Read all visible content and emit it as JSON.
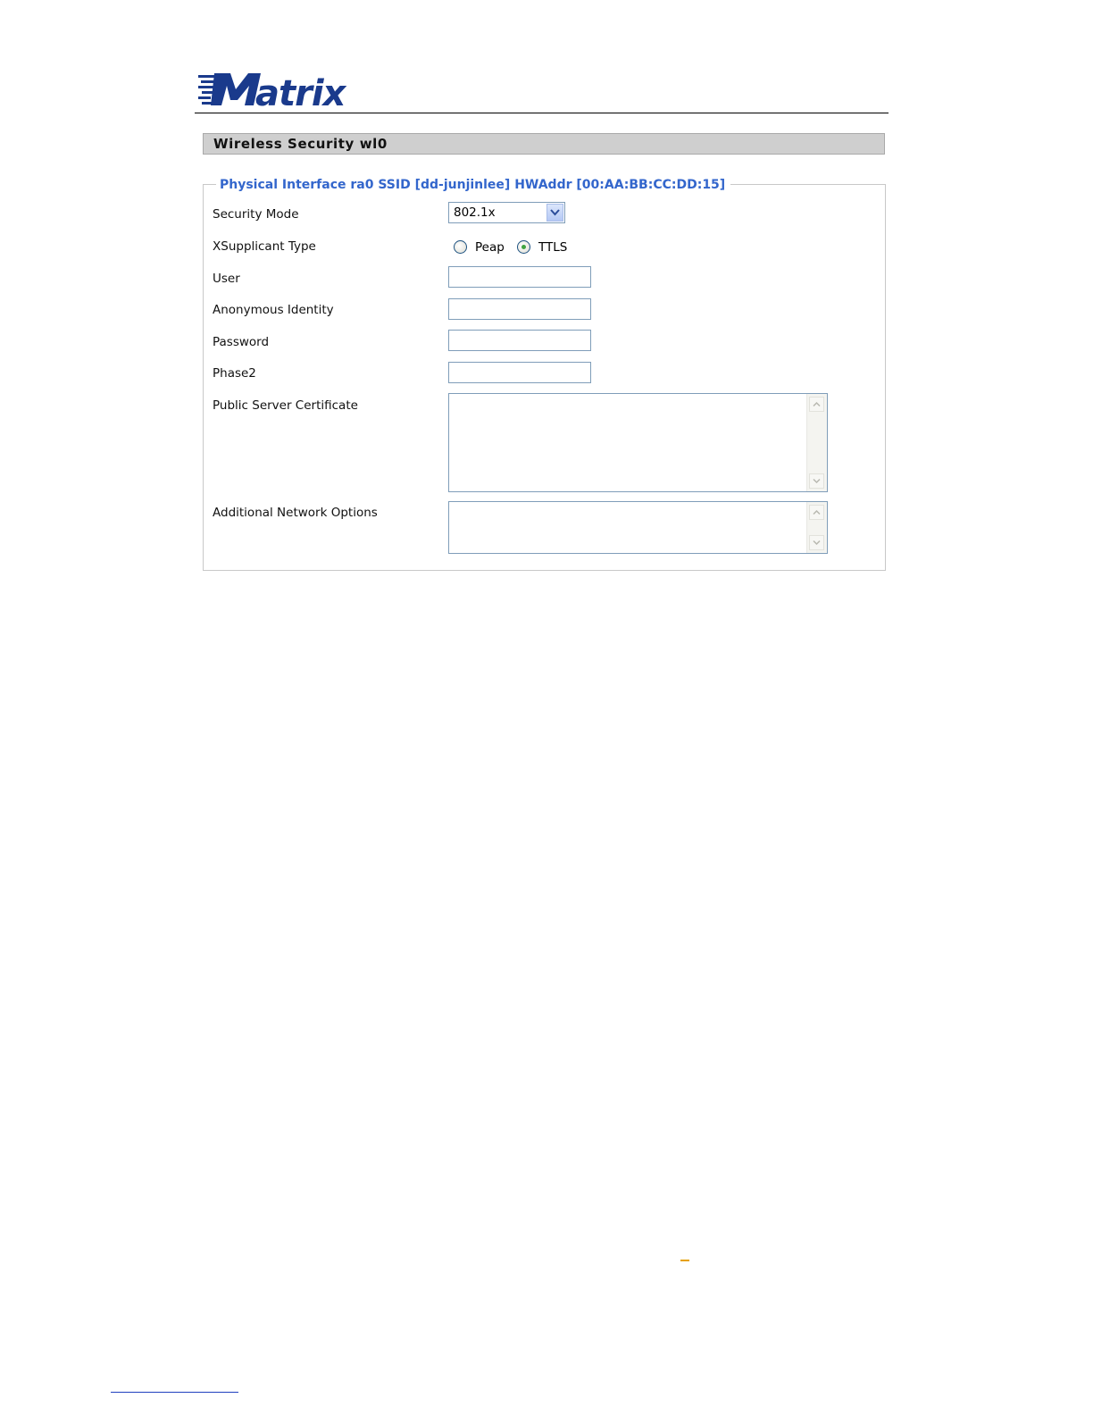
{
  "brand": {
    "logo_text": "Matrix",
    "logo_color": "#1a3a8c"
  },
  "section": {
    "title": "Wireless Security wl0"
  },
  "interface": {
    "legend": "Physical Interface ra0 SSID [dd-junjinlee] HWAddr [00:AA:BB:CC:DD:15]",
    "legend_color": "#3366cc"
  },
  "form": {
    "security_mode": {
      "label": "Security Mode",
      "value": "802.1x"
    },
    "xsupplicant_type": {
      "label": "XSupplicant Type",
      "options": [
        {
          "label": "Peap",
          "selected": false
        },
        {
          "label": "TTLS",
          "selected": true
        }
      ]
    },
    "user": {
      "label": "User",
      "value": ""
    },
    "anonymous_identity": {
      "label": "Anonymous Identity",
      "value": ""
    },
    "password": {
      "label": "Password",
      "value": ""
    },
    "phase2": {
      "label": "Phase2",
      "value": ""
    },
    "public_server_certificate": {
      "label": "Public Server Certificate",
      "value": ""
    },
    "additional_network_options": {
      "label": "Additional Network Options",
      "value": ""
    }
  }
}
